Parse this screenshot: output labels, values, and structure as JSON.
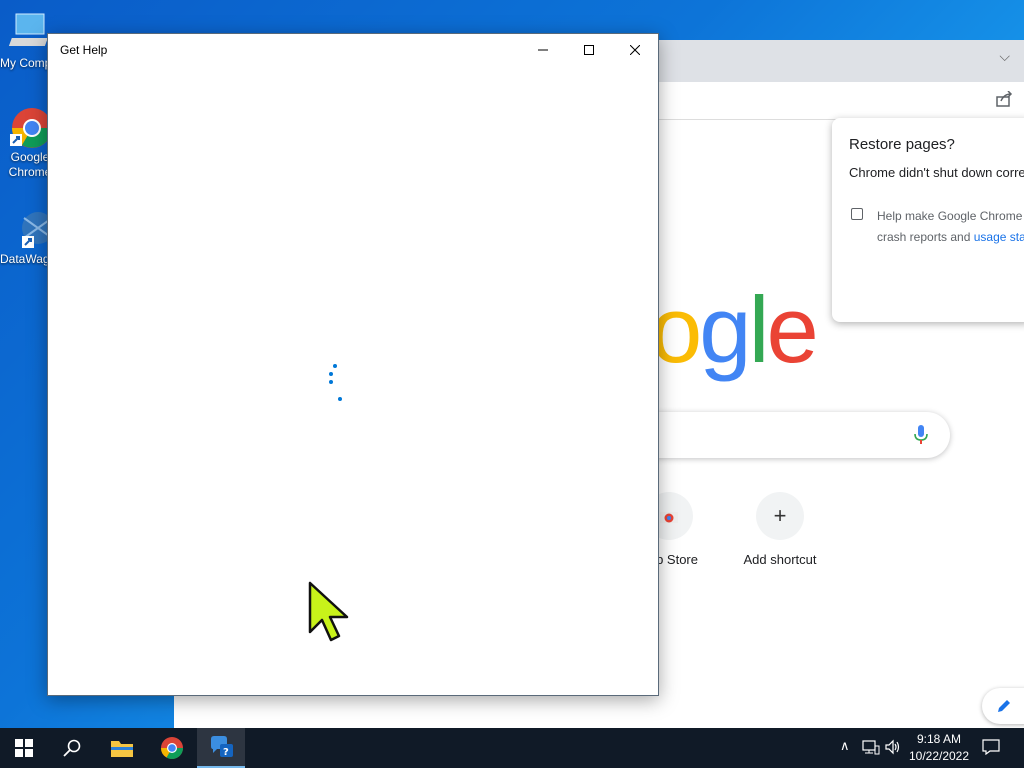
{
  "desktop": {
    "icons": [
      {
        "label": "My Computer",
        "icon": "computer-icon"
      },
      {
        "label": "Google Chrome",
        "icon": "chrome-icon"
      },
      {
        "label": "DataWagon",
        "icon": "datawagon-icon"
      }
    ]
  },
  "chrome": {
    "new_tab": {
      "logo_letters": [
        "o",
        "g",
        "l",
        "e"
      ],
      "logo_colors": [
        "#fbbc05",
        "#4285f4",
        "#34a853",
        "#ea4335"
      ],
      "shortcuts": [
        {
          "label": "eb Store",
          "icon": "web-store-icon"
        },
        {
          "label": "Add shortcut",
          "icon": "plus-icon"
        }
      ]
    },
    "restore_popup": {
      "title": "Restore pages?",
      "message": "Chrome didn't shut down corre",
      "help_line1": "Help make Google Chrome",
      "help_line2_text": "crash reports and ",
      "help_line2_link": "usage stat"
    }
  },
  "get_help": {
    "title": "Get Help",
    "accent": "#0078d7"
  },
  "taskbar": {
    "time": "9:18 AM",
    "date": "10/22/2022",
    "items": [
      "start-icon",
      "search-icon",
      "file-explorer-icon",
      "chrome-icon",
      "get-help-icon"
    ]
  }
}
